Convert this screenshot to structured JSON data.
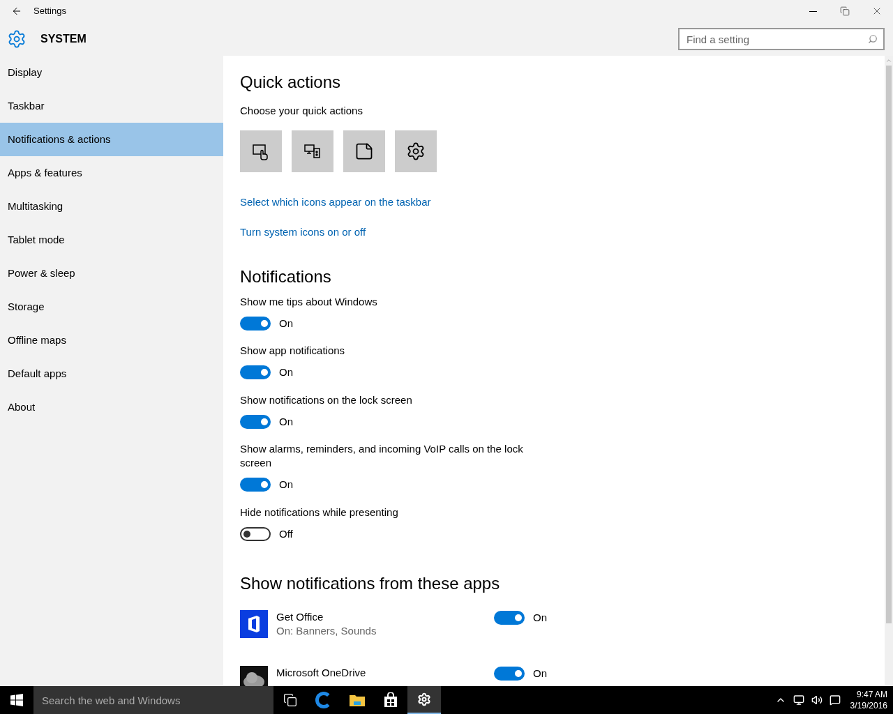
{
  "window": {
    "title": "Settings"
  },
  "header": {
    "section": "SYSTEM",
    "search": {
      "placeholder": "Find a setting"
    }
  },
  "sidebar": {
    "items": [
      {
        "label": "Display",
        "selected": false
      },
      {
        "label": "Taskbar",
        "selected": false
      },
      {
        "label": "Notifications & actions",
        "selected": true
      },
      {
        "label": "Apps & features",
        "selected": false
      },
      {
        "label": "Multitasking",
        "selected": false
      },
      {
        "label": "Tablet mode",
        "selected": false
      },
      {
        "label": "Power & sleep",
        "selected": false
      },
      {
        "label": "Storage",
        "selected": false
      },
      {
        "label": "Offline maps",
        "selected": false
      },
      {
        "label": "Default apps",
        "selected": false
      },
      {
        "label": "About",
        "selected": false
      }
    ]
  },
  "quick_actions": {
    "heading": "Quick actions",
    "subheading": "Choose your quick actions",
    "tiles": [
      {
        "kind": "tablet"
      },
      {
        "kind": "connect"
      },
      {
        "kind": "note"
      },
      {
        "kind": "settings"
      }
    ],
    "links": [
      "Select which icons appear on the taskbar",
      "Turn system icons on or off"
    ]
  },
  "notifications": {
    "heading": "Notifications",
    "toggles": [
      {
        "label": "Show me tips about Windows",
        "on": true,
        "state_label": "On"
      },
      {
        "label": "Show app notifications",
        "on": true,
        "state_label": "On"
      },
      {
        "label": "Show notifications on the lock screen",
        "on": true,
        "state_label": "On"
      },
      {
        "label": "Show alarms, reminders, and incoming VoIP calls on the lock screen",
        "on": true,
        "state_label": "On"
      },
      {
        "label": "Hide notifications while presenting",
        "on": false,
        "state_label": "Off"
      }
    ]
  },
  "apps": {
    "heading": "Show notifications from these apps",
    "items": [
      {
        "kind": "office",
        "name": "Get Office",
        "detail": "On: Banners, Sounds",
        "on": true,
        "state_label": "On"
      },
      {
        "kind": "onedrive",
        "name": "Microsoft OneDrive",
        "on": true,
        "state_label": "On"
      }
    ]
  },
  "taskbar": {
    "search": {
      "placeholder": "Search the web and Windows"
    },
    "apps": [
      {
        "kind": "task-view",
        "selected": false
      },
      {
        "kind": "edge",
        "selected": false
      },
      {
        "kind": "explorer",
        "selected": false
      },
      {
        "kind": "store",
        "selected": false
      },
      {
        "kind": "settings",
        "selected": true
      }
    ],
    "time": "9:47 AM",
    "date": "3/19/2016"
  }
}
